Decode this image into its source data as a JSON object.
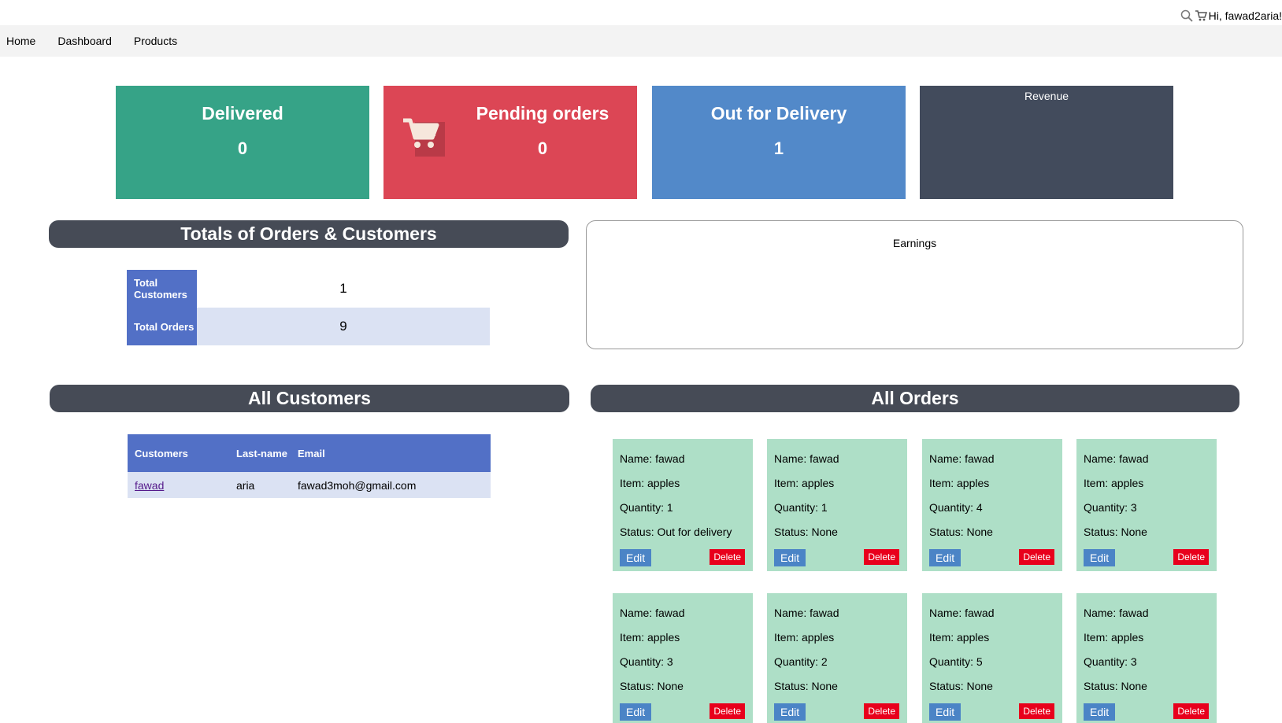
{
  "header": {
    "greeting": "Hi, fawad2aria!"
  },
  "nav": {
    "items": [
      {
        "label": "Home"
      },
      {
        "label": "Dashboard"
      },
      {
        "label": "Products"
      }
    ]
  },
  "stats": {
    "delivered": {
      "title": "Delivered",
      "value": "0"
    },
    "pending": {
      "title": "Pending orders",
      "value": "0"
    },
    "out_for_delivery": {
      "title": "Out for Delivery",
      "value": "1"
    },
    "revenue": {
      "title": "Revenue"
    }
  },
  "totals": {
    "header": "Totals of Orders & Customers",
    "rows": [
      {
        "label": "Total Customers",
        "value": "1"
      },
      {
        "label": "Total Orders",
        "value": "9"
      }
    ]
  },
  "earnings": {
    "title": "Earnings"
  },
  "customers": {
    "header": "All Customers",
    "columns": [
      "Customers",
      "Last-name",
      "Email"
    ],
    "rows": [
      {
        "first": "fawad",
        "last": "aria",
        "email": "fawad3moh@gmail.com"
      }
    ]
  },
  "orders": {
    "header": "All Orders",
    "edit_label": "Edit",
    "delete_label": "Delete",
    "items": [
      {
        "name": "Name: fawad",
        "item": "Item: apples",
        "quantity": "Quantity: 1",
        "status": "Status: Out for delivery"
      },
      {
        "name": "Name: fawad",
        "item": "Item: apples",
        "quantity": "Quantity: 1",
        "status": "Status: None"
      },
      {
        "name": "Name: fawad",
        "item": "Item: apples",
        "quantity": "Quantity: 4",
        "status": "Status: None"
      },
      {
        "name": "Name: fawad",
        "item": "Item: apples",
        "quantity": "Quantity: 3",
        "status": "Status: None"
      },
      {
        "name": "Name: fawad",
        "item": "Item: apples",
        "quantity": "Quantity: 3",
        "status": "Status: None"
      },
      {
        "name": "Name: fawad",
        "item": "Item: apples",
        "quantity": "Quantity: 2",
        "status": "Status: None"
      },
      {
        "name": "Name: fawad",
        "item": "Item: apples",
        "quantity": "Quantity: 5",
        "status": "Status: None"
      },
      {
        "name": "Name: fawad",
        "item": "Item: apples",
        "quantity": "Quantity: 3",
        "status": "Status: None"
      }
    ]
  },
  "colors": {
    "delivered": "#36a387",
    "pending": "#dc4655",
    "out_for_delivery": "#5289c9",
    "revenue": "#424b5c",
    "section_header": "#464b56",
    "table_header": "#5270c6",
    "order_card": "#aedfc7",
    "edit_button": "#4b84c6",
    "delete_button": "#e8001c"
  }
}
